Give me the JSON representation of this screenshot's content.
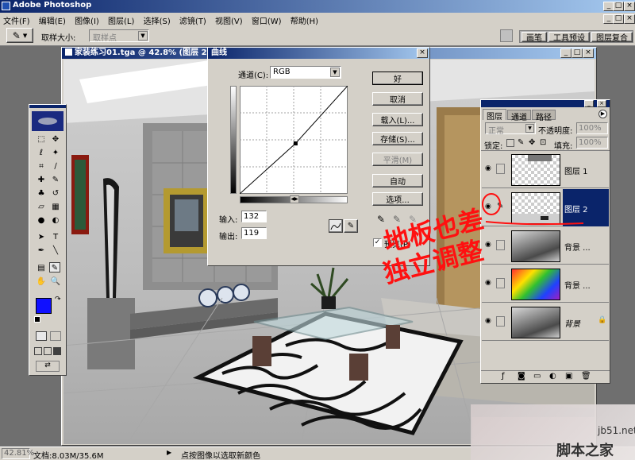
{
  "app": {
    "title": "Adobe Photoshop",
    "controls": [
      "_",
      "□",
      "×"
    ]
  },
  "menu": [
    "文件(F)",
    "编辑(E)",
    "图像(I)",
    "图层(L)",
    "选择(S)",
    "滤镜(T)",
    "视图(V)",
    "窗口(W)",
    "帮助(H)"
  ],
  "options": {
    "sample_label": "取样大小:",
    "sample_value": "取样点"
  },
  "palette_tabs": [
    "画笔",
    "工具预设",
    "图层复合"
  ],
  "document": {
    "title": "家装练习01.tga @ 42.8% (图层 2, RGB"
  },
  "curves": {
    "title": "曲线",
    "channel_label": "通道(C):",
    "channel_value": "RGB",
    "input_label": "输入:",
    "input_value": "132",
    "output_label": "输出:",
    "output_value": "119",
    "buttons": [
      "好",
      "取消",
      "载入(L)...",
      "存储(S)...",
      "平滑(M)",
      "自动",
      "选项..."
    ],
    "preview_label": "预览(P)",
    "point": {
      "input": 132,
      "output": 119
    }
  },
  "layers_panel": {
    "tabs": [
      "图层",
      "通道",
      "路径"
    ],
    "blend_mode": "正常",
    "opacity_label": "不透明度:",
    "opacity_value": "100%",
    "lock_label": "锁定:",
    "fill_label": "填充:",
    "fill_value": "100%",
    "layers": [
      {
        "name": "图层 1",
        "selected": false
      },
      {
        "name": "图层 2",
        "selected": true
      },
      {
        "name": "背景 ...",
        "selected": false
      },
      {
        "name": "背景 ...",
        "selected": false
      },
      {
        "name": "背景",
        "selected": false
      }
    ]
  },
  "annotation": {
    "line1": "地板也差",
    "line2": "独立调整"
  },
  "status": {
    "zoom": "42.81%",
    "doc_size": "文档:8.03M/35.6M",
    "hint": "点按图像以选取新颜色"
  },
  "watermark": {
    "site": "jb51.net",
    "name": "脚本之家"
  },
  "colors": {
    "foreground": "#1010ff",
    "background": "#ffffff",
    "titlebar": "#0a246a",
    "annotation": "#ff1010"
  }
}
